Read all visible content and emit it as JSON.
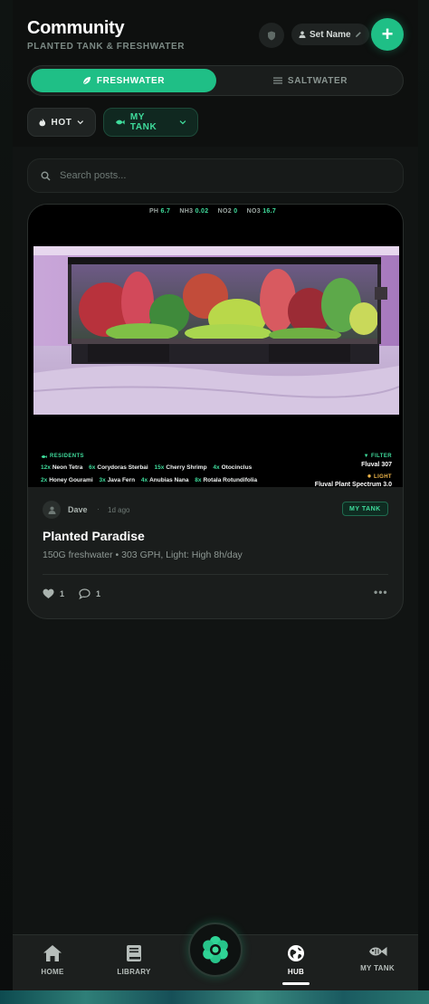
{
  "header": {
    "title": "Community",
    "subtitle": "PLANTED TANK & FRESHWATER",
    "set_name_label": "Set Name",
    "add_label": "+"
  },
  "segments": {
    "freshwater": "FRESHWATER",
    "saltwater": "SALTWATER",
    "active": "freshwater"
  },
  "filters": {
    "hot": "HOT",
    "my_tank": "MY TANK"
  },
  "search": {
    "placeholder": "Search posts..."
  },
  "post": {
    "params": [
      {
        "label": "PH",
        "value": "6.7"
      },
      {
        "label": "NH3",
        "value": "0.02"
      },
      {
        "label": "NO2",
        "value": "0"
      },
      {
        "label": "NO3",
        "value": "16.7"
      }
    ],
    "residents_label": "RESIDENTS",
    "residents_row1": [
      {
        "qty": "12x",
        "name": "Neon Tetra"
      },
      {
        "qty": "6x",
        "name": "Corydoras Sterbai"
      },
      {
        "qty": "15x",
        "name": "Cherry Shrimp"
      },
      {
        "qty": "4x",
        "name": "Otocinclus"
      }
    ],
    "residents_row2": [
      {
        "qty": "2x",
        "name": "Honey Gourami"
      },
      {
        "qty": "3x",
        "name": "Java Fern"
      },
      {
        "qty": "4x",
        "name": "Anubias Nana"
      },
      {
        "qty": "8x",
        "name": "Rotala Rotundifolia"
      }
    ],
    "filter_label": "FILTER",
    "filter_name": "Fluval 307",
    "light_label": "LIGHT",
    "light_name": "Fluval Plant Spectrum 3.0",
    "author": "Dave",
    "time": "1d ago",
    "badge": "MY TANK",
    "title": "Planted Paradise",
    "description": "150G freshwater • 303 GPH, Light: High 8h/day",
    "likes": "1",
    "comments": "1"
  },
  "nav": {
    "home": "HOME",
    "library": "LIBRARY",
    "hub": "HUB",
    "my_tank": "MY TANK",
    "active": "hub"
  },
  "colors": {
    "accent": "#1fbf86",
    "accent_text": "#3fdc9c",
    "light_accent": "#f2b84b",
    "background": "#111413"
  }
}
